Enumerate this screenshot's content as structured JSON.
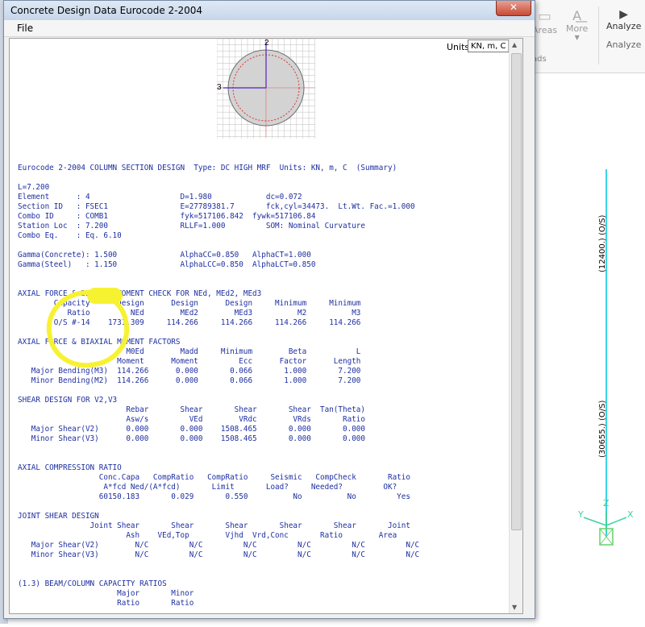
{
  "window": {
    "title": "Concrete Design Data  Eurocode 2-2004",
    "close_label": "✕"
  },
  "menu": {
    "file_label": "File"
  },
  "units": {
    "label": "Units",
    "value": "KN, m, C"
  },
  "background_ribbon": {
    "areas_label": "Areas",
    "more_label": "More",
    "analyze_label": "Analyze",
    "analyze_group_label": "Analyze",
    "ads_label": "ads"
  },
  "background_model": {
    "upper_label": "(12400.) (O/S)",
    "lower_label": "(30655.) (O/S)",
    "axis_x": "X",
    "axis_y": "Y",
    "axis_z": "Z"
  },
  "section_figure": {
    "axis_2": "2",
    "axis_3": "3"
  },
  "report": {
    "lines": [
      "Eurocode 2-2004 COLUMN SECTION DESIGN  Type: DC HIGH MRF  Units: KN, m, C  (Summary)",
      "",
      "L=7.200",
      "Element      : 4                    D=1.980            dc=0.072",
      "Section ID   : FSEC1                E=27789381.7       fck,cyl=34473.  Lt.Wt. Fac.=1.000",
      "Combo ID     : COMB1                fyk=517106.842  fywk=517106.84",
      "Station Loc  : 7.200                RLLF=1.000         SOM: Nominal Curvature",
      "Combo Eq.    : Eq. 6.10",
      "",
      "Gamma(Concrete): 1.500              AlphaCC=0.850   AlphaCT=1.000",
      "Gamma(Steel)   : 1.150              AlphaLCC=0.850  AlphaLCT=0.850",
      "",
      "",
      "AXIAL FORCE & BIAXIAL MOMENT CHECK FOR NEd, MEd2, MEd3",
      "        Capacity      Design      Design      Design     Minimum     Minimum",
      "           Ratio         NEd        MEd2        MEd3          M2          M3",
      "        O/S #-14    1731.309     114.266     114.266     114.266     114.266",
      "",
      "AXIAL FORCE & BIAXIAL MOMENT FACTORS",
      "                        M0Ed        Madd     Minimum        Beta           L",
      "                      Moment      Moment         Ecc      Factor      Length",
      "   Major Bending(M3)  114.266      0.000       0.066       1.000       7.200",
      "   Minor Bending(M2)  114.266      0.000       0.066       1.000       7.200",
      "",
      "SHEAR DESIGN FOR V2,V3",
      "                        Rebar       Shear       Shear       Shear  Tan(Theta)",
      "                        Asw/s         VEd        VRdc        VRds       Ratio",
      "   Major Shear(V2)      0.000       0.000    1508.465       0.000       0.000",
      "   Minor Shear(V3)      0.000       0.000    1508.465       0.000       0.000",
      "",
      "",
      "AXIAL COMPRESSION RATIO",
      "                  Conc.Capa   CompRatio   CompRatio     Seismic   CompCheck       Ratio",
      "                   A*fcd Ned/(A*fcd)       Limit       Load?     Needed?         OK?",
      "                  60150.183       0.029       0.550          No          No         Yes",
      "",
      "JOINT SHEAR DESIGN",
      "                Joint Shear       Shear       Shear       Shear       Shear       Joint",
      "                        Ash    VEd,Top        Vjhd  Vrd,Conc       Ratio        Area",
      "   Major Shear(V2)        N/C         N/C         N/C         N/C         N/C         N/C",
      "   Minor Shear(V3)        N/C         N/C         N/C         N/C         N/C         N/C",
      "",
      "",
      "(1.3) BEAM/COLUMN CAPACITY RATIOS",
      "                      Major       Minor",
      "                      Ratio       Ratio"
    ]
  }
}
